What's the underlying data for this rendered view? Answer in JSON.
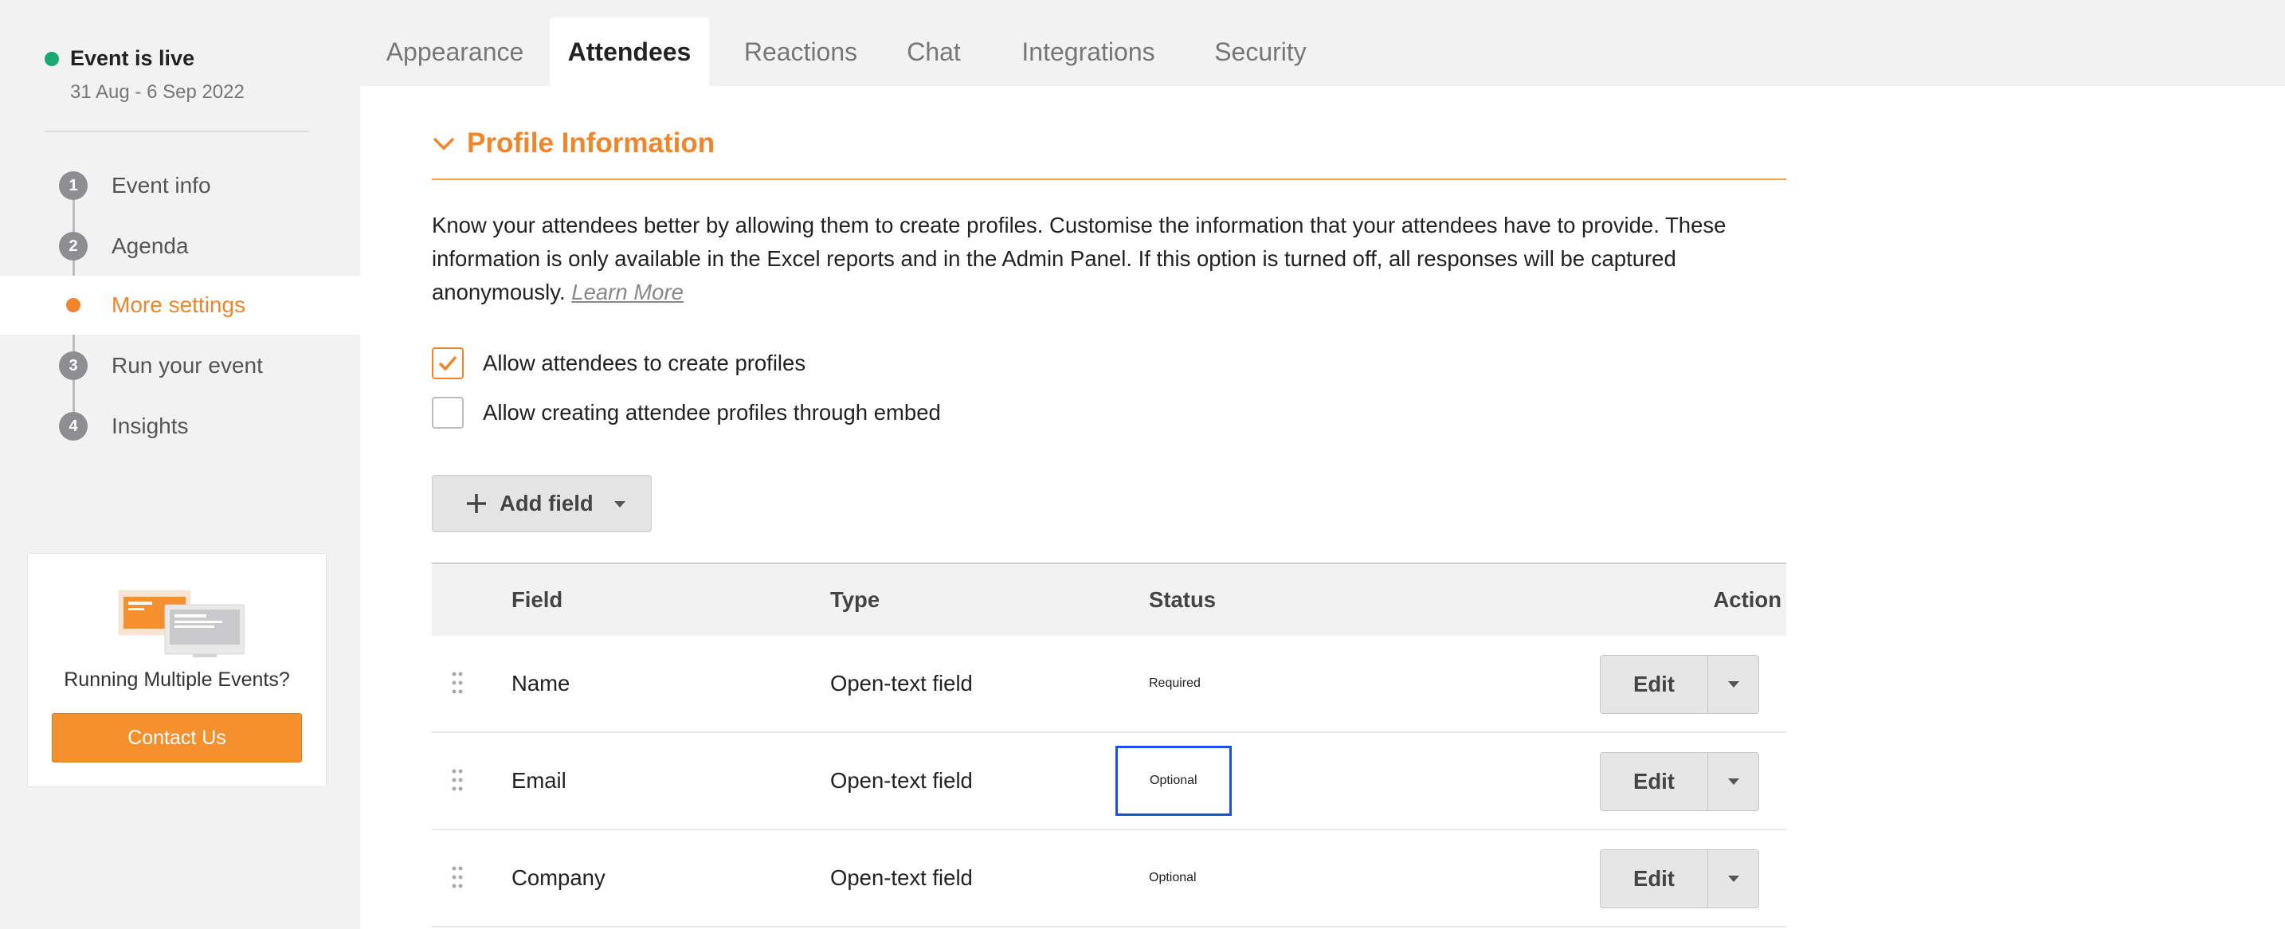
{
  "sidebar": {
    "status": {
      "label": "Event is live",
      "dates": "31 Aug - 6 Sep 2022",
      "color": "#1aa874"
    },
    "nav": [
      {
        "number": "1",
        "label": "Event info",
        "active": false
      },
      {
        "number": "2",
        "label": "Agenda",
        "active": false
      },
      {
        "number": "",
        "label": "More settings",
        "active": true
      },
      {
        "number": "3",
        "label": "Run your event",
        "active": false
      },
      {
        "number": "4",
        "label": "Insights",
        "active": false
      }
    ],
    "promo": {
      "text": "Running Multiple Events?",
      "button": "Contact Us"
    }
  },
  "tabs": [
    {
      "label": "Appearance",
      "active": false
    },
    {
      "label": "Attendees",
      "active": true
    },
    {
      "label": "Reactions",
      "active": false
    },
    {
      "label": "Chat",
      "active": false
    },
    {
      "label": "Integrations",
      "active": false
    },
    {
      "label": "Security",
      "active": false
    }
  ],
  "section": {
    "title": "Profile Information",
    "description": "Know your attendees better by allowing them to create profiles. Customise the information that your attendees have to provide. These information is only available in the Excel reports and in the Admin Panel. If this option is turned off, all responses will be captured anonymously.",
    "learn_more": "Learn More",
    "checkboxes": [
      {
        "label": "Allow attendees to create profiles",
        "checked": true
      },
      {
        "label": "Allow creating attendee profiles through embed",
        "checked": false
      }
    ],
    "add_field": "Add field"
  },
  "table": {
    "headers": {
      "field": "Field",
      "type": "Type",
      "status": "Status",
      "action": "Action"
    },
    "rows": [
      {
        "field": "Name",
        "type": "Open-text field",
        "status": "Required",
        "action": "Edit"
      },
      {
        "field": "Email",
        "type": "Open-text field",
        "status": "Optional",
        "action": "Edit"
      },
      {
        "field": "Company",
        "type": "Open-text field",
        "status": "Optional",
        "action": "Edit"
      }
    ]
  },
  "colors": {
    "accent": "#f0852a",
    "focus_outline": "#1a4fe8"
  }
}
